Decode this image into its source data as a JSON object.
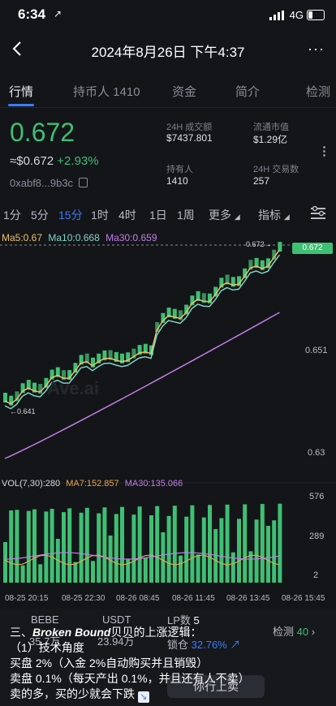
{
  "status_bar": {
    "time": "6:34",
    "location_glyph": "↗",
    "network": "4G"
  },
  "header": {
    "title": "2024年8月26日 下午4:37",
    "more": "···"
  },
  "tabs": [
    {
      "label": "行情",
      "active": true
    },
    {
      "label": "持币人 1410",
      "active": false
    },
    {
      "label": "资金",
      "active": false
    },
    {
      "label": "简介",
      "active": false
    },
    {
      "label": "检测",
      "active": false
    }
  ],
  "token": {
    "price": "0.672",
    "usd_price": "≈$0.672",
    "change": "+2.93%",
    "address": "0xabf8...9b3c",
    "change_color": "#3fbf74"
  },
  "stats": {
    "vol_label": "24H 成交额",
    "vol_value": "$7437.801",
    "mcap_label": "流通市值",
    "mcap_value": "$1.29亿",
    "holders_label": "持有人",
    "holders_value": "1410",
    "tx_label": "24H 交易数",
    "tx_value": "257"
  },
  "intervals": [
    "1分",
    "5分",
    "15分",
    "1时",
    "4时",
    "1日",
    "1周",
    "更多",
    "指标"
  ],
  "active_interval": "15分",
  "ma": {
    "ma5": "Ma5:0.67",
    "ma10": "Ma10:0.668",
    "ma30": "Ma30:0.659"
  },
  "price_chart": {
    "current_tag": "0.672",
    "last_marker": "0.672→",
    "low_marker": "←0.641",
    "axis_ticks": [
      "0.651",
      "0.63"
    ],
    "watermark": "Ave.ai"
  },
  "volume": {
    "label": "VOL(7,30):280",
    "ma7": "MA7:152.857",
    "ma30": "MA30:135.066",
    "axis_ticks": [
      "576",
      "289",
      "2"
    ]
  },
  "time_axis": [
    "08-25 20:15",
    "08-25 22:30",
    "08-26 08:45",
    "08-26 11:45",
    "08-26 13:45",
    "08-26 15:45"
  ],
  "bottom": {
    "pair_left": "BEBE",
    "pair_right": "USDT",
    "liq_left": "35.7万",
    "liq_right": "23.94万",
    "lp_label": "LP数",
    "lp_value": "5",
    "lock_label": "锁仓",
    "lock_value": "32.76%",
    "detect_label": "检测",
    "detect_value": "40",
    "button_label": "你行上卖"
  },
  "caption": {
    "line1_prefix": "三、",
    "line1_bold": "Broken Bound",
    "line1_rest": "贝贝的上涨逻辑：",
    "line2": "（1）技术角度",
    "line3": "买盘 2%（入金 2%自动购买并且销毁）",
    "line4": "卖盘 0.1%（每天产出 0.1%，并且还有人不卖）",
    "line5": "卖的多，买的少就会下跌"
  },
  "colors": {
    "accent": "#3b7cf6",
    "up": "#3fbf74",
    "ma5": "#e8c26a",
    "ma10": "#7fd4c8",
    "ma30": "#c27fe6",
    "background": "#141519"
  }
}
